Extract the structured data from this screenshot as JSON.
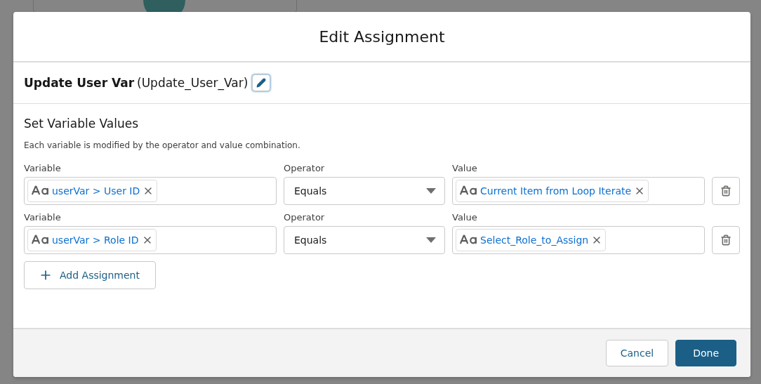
{
  "dialog": {
    "title": "Edit Assignment",
    "element": {
      "label": "Update User Var",
      "api_name": "(Update_User_Var)"
    },
    "section": {
      "title": "Set Variable Values",
      "description": "Each variable is modified by the operator and value combination."
    },
    "assignments": [
      {
        "variable_label": "Variable",
        "variable": "userVar > User ID",
        "operator_label": "Operator",
        "operator": "Equals",
        "value_label": "Value",
        "value": "Current Item from Loop Iterate"
      },
      {
        "variable_label": "Variable",
        "variable": "userVar > Role ID",
        "operator_label": "Operator",
        "operator": "Equals",
        "value_label": "Value",
        "value": "Select_Role_to_Assign"
      }
    ],
    "add_button": "Add Assignment",
    "buttons": [
      {
        "label": "Cancel",
        "kind": "neutral"
      },
      {
        "label": "Done",
        "kind": "brand"
      }
    ]
  }
}
